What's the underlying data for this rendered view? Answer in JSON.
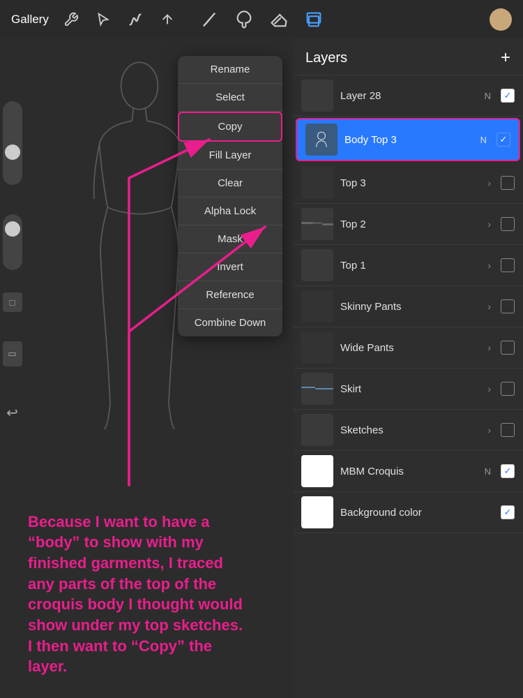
{
  "toolbar": {
    "gallery_label": "Gallery",
    "add_layers_btn": "+",
    "tools": [
      "wrench",
      "arrow",
      "S-curve",
      "arrow-up"
    ]
  },
  "context_menu": {
    "items": [
      {
        "label": "Rename",
        "highlighted": false
      },
      {
        "label": "Select",
        "highlighted": false
      },
      {
        "label": "Copy",
        "highlighted": true
      },
      {
        "label": "Fill Layer",
        "highlighted": false
      },
      {
        "label": "Clear",
        "highlighted": false
      },
      {
        "label": "Alpha Lock",
        "highlighted": false
      },
      {
        "label": "Mask",
        "highlighted": false
      },
      {
        "label": "Invert",
        "highlighted": false
      },
      {
        "label": "Reference",
        "highlighted": false
      },
      {
        "label": "Combine Down",
        "highlighted": false
      }
    ]
  },
  "layers_panel": {
    "title": "Layers",
    "layers": [
      {
        "name": "Layer 28",
        "n_badge": "N",
        "checked": true,
        "active": false,
        "thumb": "dark"
      },
      {
        "name": "Body Top 3",
        "n_badge": "N",
        "checked": true,
        "active": true,
        "thumb": "figure"
      },
      {
        "name": "Top 3",
        "n_badge": "",
        "checked": false,
        "active": false,
        "thumb": "sketch"
      },
      {
        "name": "Top 2",
        "n_badge": "",
        "checked": false,
        "active": false,
        "thumb": "sketch2"
      },
      {
        "name": "Top 1",
        "n_badge": "",
        "checked": false,
        "active": false,
        "thumb": "sketch3"
      },
      {
        "name": "Skinny Pants",
        "n_badge": "",
        "checked": false,
        "active": false,
        "thumb": "sketch4"
      },
      {
        "name": "Wide Pants",
        "n_badge": "",
        "checked": false,
        "active": false,
        "thumb": "sketch5"
      },
      {
        "name": "Skirt",
        "n_badge": "",
        "checked": false,
        "active": false,
        "thumb": "sketch6"
      },
      {
        "name": "Sketches",
        "n_badge": "",
        "checked": false,
        "active": false,
        "thumb": "sketch7"
      },
      {
        "name": "MBM Croquis",
        "n_badge": "N",
        "checked": true,
        "active": false,
        "thumb": "white"
      },
      {
        "name": "Background color",
        "n_badge": "",
        "checked": true,
        "active": false,
        "thumb": "white"
      }
    ]
  },
  "annotation": {
    "text": "Because I want to have a “body” to show with my finished garments, I traced any parts of the top of the croquis body I thought would show under my top sketches. I then want to “Copy” the layer."
  },
  "colors": {
    "accent_pink": "#e91e8c",
    "active_blue": "#2979ff",
    "panel_bg": "#2e2e2e",
    "toolbar_bg": "#2a2a2a"
  }
}
